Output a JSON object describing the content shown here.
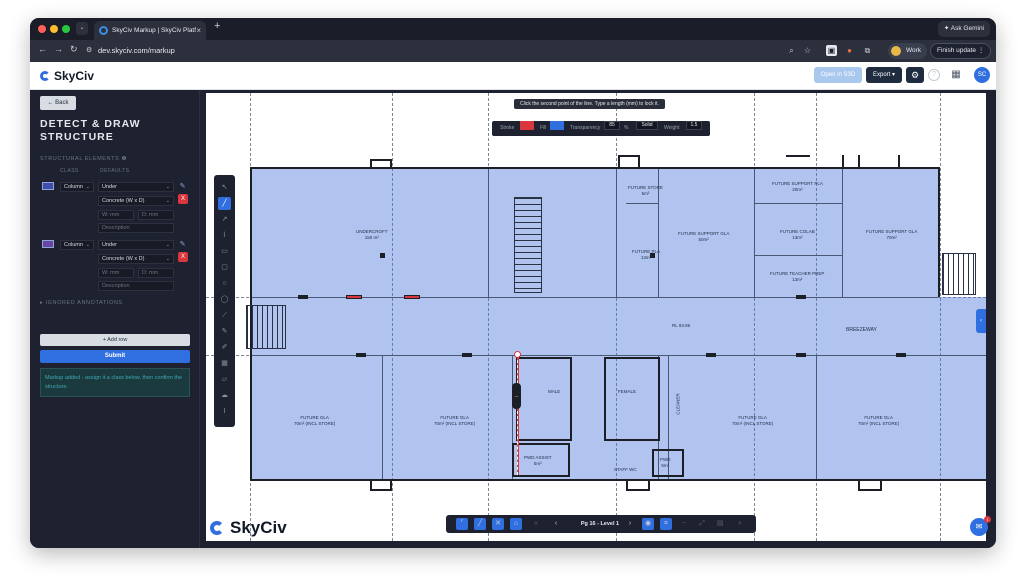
{
  "browser": {
    "tab_title": "SkyCiv Markup | SkyCiv Platf",
    "tab_close": "×",
    "new_tab": "+",
    "gemini": "✦ Ask Gemini",
    "url": "dev.skyciv.com/markup",
    "profile": "Work",
    "finish_update": "Finish update ⋮"
  },
  "header": {
    "logo": "SkyCiv",
    "open_s3d": "Open in S3D",
    "export": "Export ▾",
    "gear": "⚙",
    "help": "?",
    "apps": "▦",
    "avatar": "SC"
  },
  "sidebar": {
    "back": "← Back",
    "title": "DETECT & DRAW STRUCTURE",
    "section_label": "STRUCTURAL ELEMENTS ❶",
    "col_class": "CLASS",
    "col_defaults": "DEFAULTS",
    "rows": [
      {
        "class": "Column",
        "support": "Under",
        "material": "Concrete (W x D)",
        "w": "W: mm",
        "d": "D: mm",
        "desc": "Description",
        "swatch": "#3d4fa8"
      },
      {
        "class": "Column",
        "support": "Under",
        "material": "Concrete (W x D)",
        "w": "W: mm",
        "d": "D: mm",
        "desc": "Description",
        "swatch": "#6a45a8"
      }
    ],
    "ignored": "▸ IGNORED ANNOTATIONS",
    "add_row": "+ Add row",
    "submit": "Submit",
    "info": "Markup added - assign it a class below, then confirm the structure."
  },
  "canvas": {
    "hint": "Click the second point of the line. Type a length (mm) to lock it.",
    "stroke_label": "Stroke",
    "fill_label": "Fill",
    "transparency_label": "Transparency",
    "transparency_value": "85",
    "transparency_unit": "%",
    "line_style": "Solid",
    "weight_label": "Weight",
    "weight_value": "1.5",
    "stroke_color": "#d9363e",
    "fill_color": "#2f6fe0",
    "page_label": "Pg 16 - Level 1",
    "watermark": "SkyCiv",
    "level": "RL 93.85"
  },
  "rooms": {
    "undercroft": "UNDERCROFT",
    "undercroft_area": "150 m²",
    "future_store": "FUTURE STORE",
    "future_store_area": "5m²",
    "fsgla1": "FUTURE SUPPORT GLA",
    "fsgla1_area": "50m²",
    "fspla": "FUTURE SUPPORT PLA",
    "fspla_area": "20m²",
    "fsgla2": "FUTURE SUPPORT GLA",
    "fsgla2_area": "70m²",
    "future_pla": "FUTURE PLA",
    "future_pla_area": "13m²",
    "future_colab": "FUTURE COLAB",
    "future_colab_area": "13m²",
    "teacher_prep": "FUTURE TEACHER PREP",
    "teacher_prep_area": "13m²",
    "breezeway": "BREEZEWAY",
    "gla1": "FUTURE GLA",
    "gla1_sub": "70m² (INCL STORE)",
    "gla2": "FUTURE GLA",
    "gla2_sub": "70m² (INCL STORE)",
    "gla3": "FUTURE GLA",
    "gla3_sub": "70m² (INCL STORE)",
    "gla4": "FUTURE GLA",
    "gla4_sub": "70m² (INCL STORE)",
    "male": "MALE",
    "female": "FEMALE",
    "cleaner": "CLEANER",
    "pwd_assist": "PWD ASSIST",
    "pwd_assist_area": "5m²",
    "pwd": "PWD",
    "pwd_area": "5m²",
    "staff_wc": "STAFF WC"
  }
}
